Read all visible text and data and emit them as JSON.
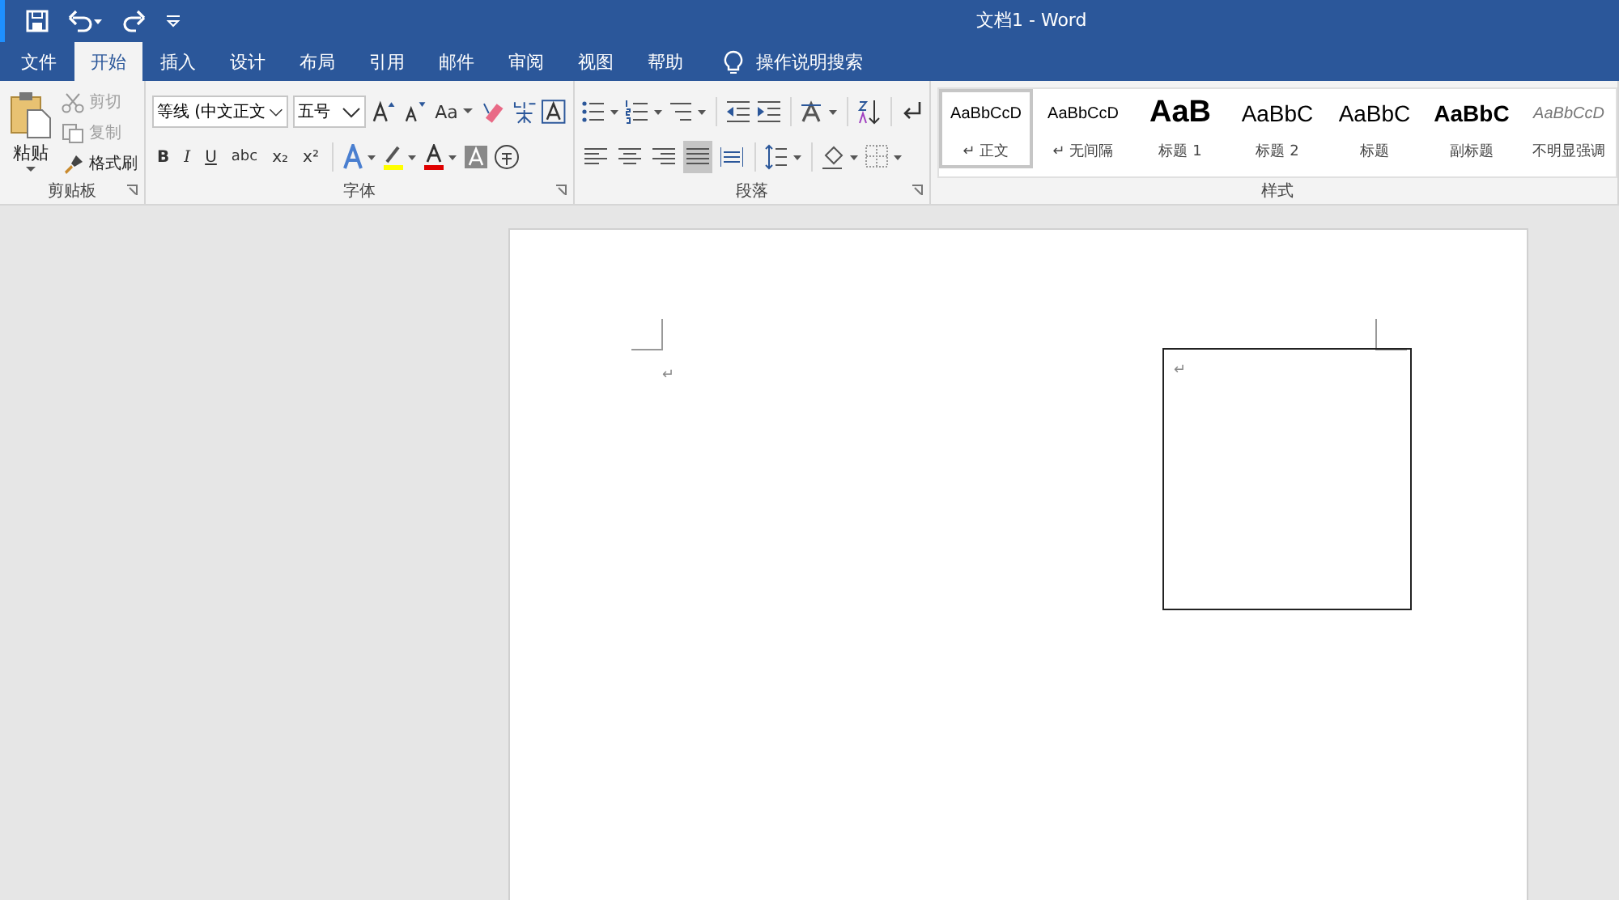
{
  "window": {
    "title": "文档1 - Word"
  },
  "tabs": [
    {
      "label": "文件",
      "selected": false
    },
    {
      "label": "开始",
      "selected": true
    },
    {
      "label": "插入",
      "selected": false
    },
    {
      "label": "设计",
      "selected": false
    },
    {
      "label": "布局",
      "selected": false
    },
    {
      "label": "引用",
      "selected": false
    },
    {
      "label": "邮件",
      "selected": false
    },
    {
      "label": "审阅",
      "selected": false
    },
    {
      "label": "视图",
      "selected": false
    },
    {
      "label": "帮助",
      "selected": false
    }
  ],
  "tell_me": "操作说明搜索",
  "clipboard": {
    "paste": "粘贴",
    "cut": {
      "label": "剪切",
      "disabled": true
    },
    "copy": {
      "label": "复制",
      "disabled": true
    },
    "format_painter": "格式刷",
    "group_label": "剪贴板"
  },
  "font": {
    "name": "等线 (中文正文",
    "size": "五号",
    "change_case": "Aa",
    "format_buttons": [
      "B",
      "I",
      "U",
      "abc",
      "x₂",
      "x²"
    ],
    "group_label": "字体"
  },
  "paragraph": {
    "alignment": [
      {
        "selected": false
      },
      {
        "selected": false
      },
      {
        "selected": false
      },
      {
        "selected": true
      },
      {
        "selected": false
      }
    ],
    "group_label": "段落"
  },
  "styles": {
    "items": [
      {
        "preview": "AaBbCcD",
        "name": "↵ 正文",
        "kind": "normal",
        "selected": true
      },
      {
        "preview": "AaBbCcD",
        "name": "↵ 无间隔",
        "kind": "normal",
        "selected": false
      },
      {
        "preview": "AaB",
        "name": "标题 1",
        "kind": "heading1",
        "selected": false
      },
      {
        "preview": "AaBbC",
        "name": "标题 2",
        "kind": "heading2",
        "selected": false
      },
      {
        "preview": "AaBbC",
        "name": "标题",
        "kind": "title",
        "selected": false
      },
      {
        "preview": "AaBbC",
        "name": "副标题",
        "kind": "subtitle",
        "selected": false
      },
      {
        "preview": "AaBbCcD",
        "name": "不明显强调",
        "kind": "emphasis",
        "selected": false
      }
    ],
    "group_label": "样式"
  },
  "document": {
    "paragraph_mark": "↵",
    "text_box_mark": "↵"
  }
}
